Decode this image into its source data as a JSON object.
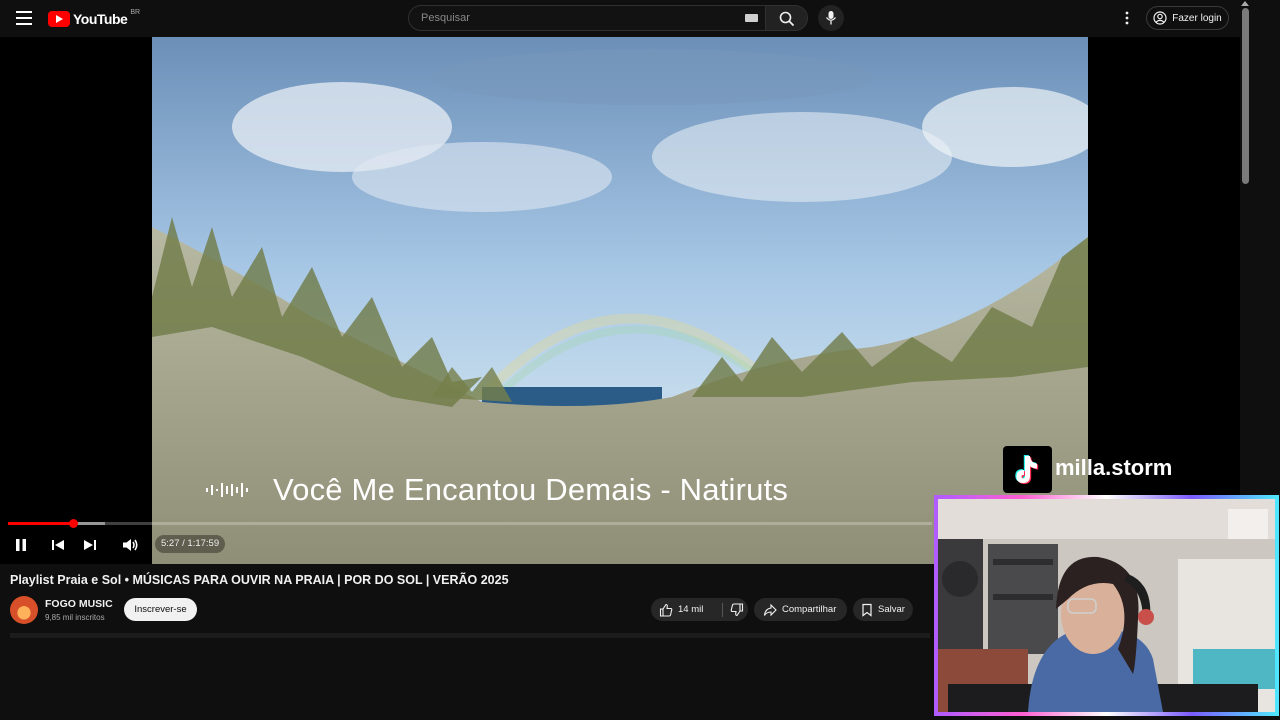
{
  "header": {
    "logo_text": "YouTube",
    "region": "BR",
    "search_placeholder": "Pesquisar",
    "login_label": "Fazer login"
  },
  "player": {
    "song_caption": "Você Me Encantou Demais - Natiruts",
    "time_display": "5:27 / 1:17:59",
    "progress_percent": 7.0
  },
  "video": {
    "title": "Playlist Praia e Sol • MÚSICAS PARA OUVIR NA PRAIA | POR DO SOL | VERÃO 2025",
    "channel_name": "FOGO MUSIC",
    "subscribers": "9,85 mil inscritos",
    "subscribe_label": "Inscrever-se",
    "likes": "14 mil",
    "share_label": "Compartilhar",
    "save_label": "Salvar"
  },
  "overlay": {
    "tiktok_handle": "milla.storm"
  },
  "colors": {
    "background": "#0f0f0f",
    "accent_red": "#ff0000",
    "pill_bg": "#272727"
  }
}
